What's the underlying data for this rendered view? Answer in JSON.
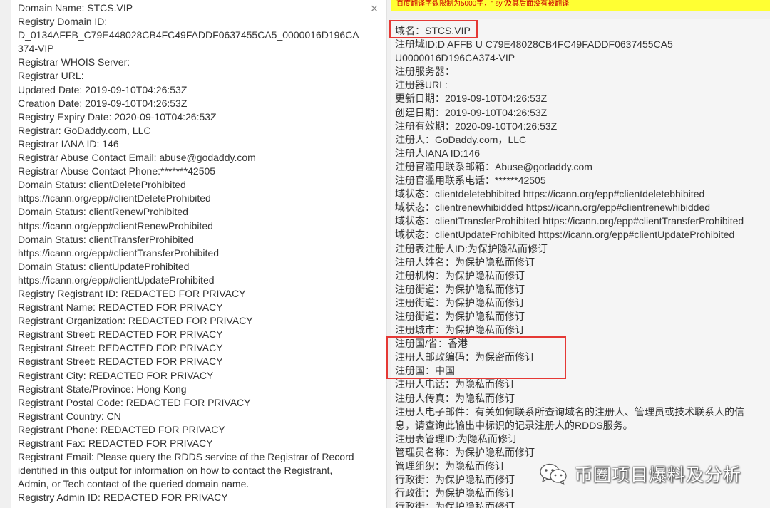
{
  "left_panel": {
    "close_icon": "×",
    "lines": [
      "Domain Name: STCS.VIP",
      "Registry Domain ID:",
      "D_0134AFFB_C79E448028CB4FC49FADDF0637455CA5_0000016D196CA",
      "374-VIP",
      "Registrar WHOIS Server:",
      "Registrar URL:",
      "Updated Date: 2019-09-10T04:26:53Z",
      "Creation Date: 2019-09-10T04:26:53Z",
      "Registry Expiry Date: 2020-09-10T04:26:53Z",
      "Registrar: GoDaddy.com, LLC",
      "Registrar IANA ID: 146",
      "Registrar Abuse Contact Email: abuse@godaddy.com",
      "Registrar Abuse Contact Phone:*******42505",
      "Domain Status: clientDeleteProhibited",
      "https://icann.org/epp#clientDeleteProhibited",
      "Domain Status: clientRenewProhibited",
      "https://icann.org/epp#clientRenewProhibited",
      "Domain Status: clientTransferProhibited",
      "https://icann.org/epp#clientTransferProhibited",
      "Domain Status: clientUpdateProhibited",
      "https://icann.org/epp#clientUpdateProhibited",
      "Registry Registrant ID: REDACTED FOR PRIVACY",
      "Registrant Name: REDACTED FOR PRIVACY",
      "Registrant Organization: REDACTED FOR PRIVACY",
      "Registrant Street: REDACTED FOR PRIVACY",
      "Registrant Street: REDACTED FOR PRIVACY",
      "Registrant Street: REDACTED FOR PRIVACY",
      "Registrant City: REDACTED FOR PRIVACY",
      "Registrant State/Province: Hong Kong",
      "Registrant Postal Code: REDACTED FOR PRIVACY",
      "Registrant Country: CN",
      "Registrant Phone: REDACTED FOR PRIVACY",
      "Registrant Fax: REDACTED FOR PRIVACY",
      "Registrant Email: Please query the RDDS service of the Registrar of Record",
      "identified in this output for information on how to contact the Registrant,",
      "Admin, or Tech contact of the queried domain name.",
      "Registry Admin ID: REDACTED FOR PRIVACY"
    ]
  },
  "warning_banner": {
    "text": "百度翻译字数限制为5000字，\" sy\"及其后面没有被翻译!"
  },
  "right_panel": {
    "lines": [
      "域名：STCS.VIP",
      "注册域ID:D AFFB U C79E48028CB4FC49FADDF0637455CA5",
      "U0000016D196CA374-VIP",
      "注册服务器：",
      "注册器URL:",
      "更新日期：2019-09-10T04:26:53Z",
      "创建日期：2019-09-10T04:26:53Z",
      "注册有效期：2020-09-10T04:26:53Z",
      "注册人：GoDaddy.com，LLC",
      "注册人IANA ID:146",
      "注册官滥用联系邮箱：Abuse@godaddy.com",
      "注册官滥用联系电话：******42505",
      "域状态：clientdeletebhibited https://icann.org/epp#clientdeletebhibited",
      "域状态：clientrenewhibidded https://icann.org/epp#clientrenewhibidded",
      "域状态：clientTransferProhibited https://icann.org/epp#clientTransferProhibited",
      "域状态：clientUpdateProhibited https://icann.org/epp#clientUpdateProhibited",
      "注册表注册人ID:为保护隐私而修订",
      "注册人姓名：为保护隐私而修订",
      "注册机构：为保护隐私而修订",
      "注册街道：为保护隐私而修订",
      "注册街道：为保护隐私而修订",
      "注册街道：为保护隐私而修订",
      "注册城市：为保护隐私而修订",
      "注册国/省：香港",
      "注册人邮政编码：为保密而修订",
      "注册国：中国",
      "注册人电话：为隐私而修订",
      "注册人传真：为隐私而修订",
      "注册人电子邮件：有关如何联系所查询域名的注册人、管理员或技术联系人的信",
      "息，请查询此输出中标识的记录注册人的RDDS服务。",
      "注册表管理ID:为隐私而修订",
      "管理员名称：为保护隐私而修订",
      "管理组织：为隐私而修订",
      "行政街：为保护隐私而修订",
      "行政街：为保护隐私而修订",
      "行政街：为保护隐私而修订"
    ]
  },
  "watermark": {
    "text": "币圈项目爆料及分析",
    "icon": "wechat-icon"
  },
  "colors": {
    "highlight_box": "#e53935",
    "warning_bg": "#ffff33",
    "warning_text": "#cc0000"
  }
}
